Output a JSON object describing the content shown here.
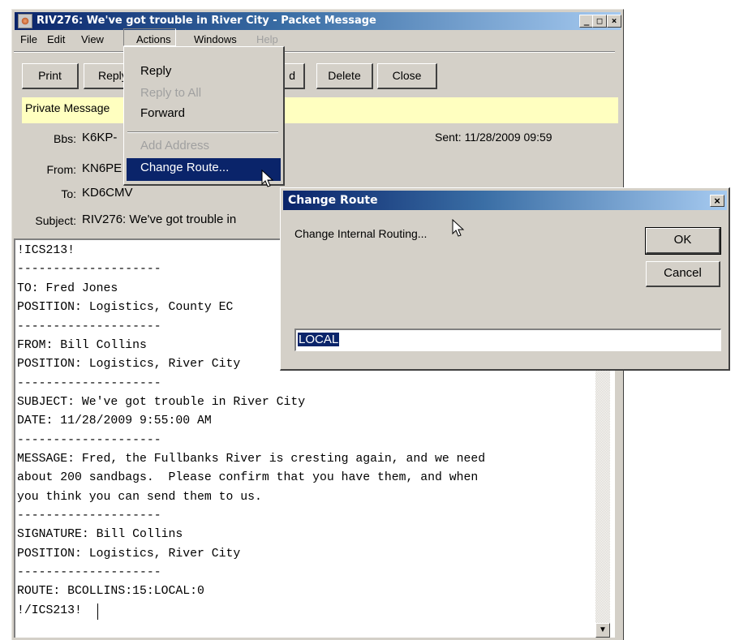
{
  "window": {
    "title": "RIV276: We've got trouble in River City - Packet Message",
    "controls": {
      "minimize": "_",
      "maximize": "□",
      "close": "×"
    }
  },
  "menubar": {
    "items": [
      {
        "label": "File",
        "enabled": true
      },
      {
        "label": "Edit",
        "enabled": true
      },
      {
        "label": "View",
        "enabled": true
      },
      {
        "label": "Actions",
        "enabled": true,
        "open": true
      },
      {
        "label": "Windows",
        "enabled": true
      },
      {
        "label": "Help",
        "enabled": false
      }
    ]
  },
  "actions_menu": {
    "items": [
      {
        "label": "Reply",
        "enabled": true
      },
      {
        "label": "Reply to All",
        "enabled": false
      },
      {
        "label": "Forward",
        "enabled": true
      },
      {
        "label": "Add Address",
        "enabled": false
      },
      {
        "label": "Change Route...",
        "enabled": true,
        "highlighted": true
      }
    ]
  },
  "toolbar": {
    "print": "Print",
    "reply": "Reply",
    "forward_partial": "d",
    "delete": "Delete",
    "close": "Close"
  },
  "private_label": "Private Message",
  "header": {
    "bbs_label": "Bbs:",
    "bbs_value": "K6KP-",
    "from_label": "From:",
    "from_value": "KN6PE",
    "to_label": "To:",
    "to_value": "KD6CMV",
    "subject_label": "Subject:",
    "subject_value": "RIV276: We've got trouble in",
    "sent": "Sent: 11/28/2009 09:59"
  },
  "message_lines": [
    "!ICS213!",
    "--------------------",
    "TO: Fred Jones",
    "POSITION: Logistics, County EC",
    "--------------------",
    "FROM: Bill Collins",
    "POSITION: Logistics, River City",
    "--------------------",
    "SUBJECT: We've got trouble in River City",
    "DATE: 11/28/2009 9:55:00 AM",
    "--------------------",
    "MESSAGE: Fred, the Fullbanks River is cresting again, and we need",
    "about 200 sandbags.  Please confirm that you have them, and when",
    "you think you can send them to us.",
    "--------------------",
    "SIGNATURE: Bill Collins",
    "POSITION: Logistics, River City",
    "--------------------",
    "ROUTE: BCOLLINS:15:LOCAL:0",
    "!/ICS213!"
  ],
  "dialog": {
    "title": "Change Route",
    "close": "×",
    "prompt": "Change Internal Routing...",
    "ok": "OK",
    "cancel": "Cancel",
    "input_value": "LOCAL"
  }
}
